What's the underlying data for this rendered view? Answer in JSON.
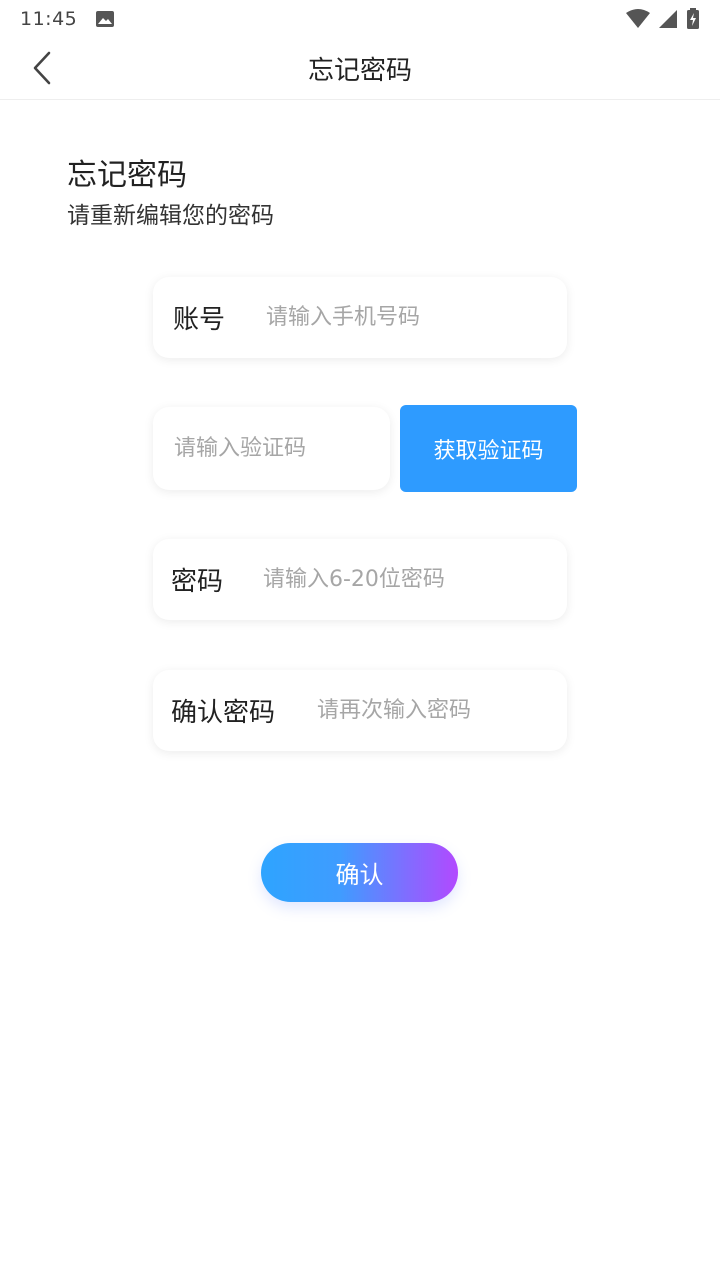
{
  "status_bar": {
    "time": "11:45",
    "icons": [
      "image-icon",
      "wifi-icon",
      "signal-icon",
      "battery-charging-icon"
    ]
  },
  "header": {
    "title": "忘记密码",
    "back_icon": "chevron-left-icon"
  },
  "intro": {
    "title": "忘记密码",
    "subtitle": "请重新编辑您的密码"
  },
  "form": {
    "account": {
      "label": "账号",
      "placeholder": "请输入手机号码",
      "value": ""
    },
    "code": {
      "placeholder": "请输入验证码",
      "value": "",
      "button_label": "获取验证码"
    },
    "password": {
      "label": "密码",
      "placeholder": "请输入6-20位密码",
      "value": ""
    },
    "confirm_password": {
      "label": "确认密码",
      "placeholder": "请再次输入密码",
      "value": ""
    }
  },
  "actions": {
    "confirm_label": "确认"
  },
  "colors": {
    "primary": "#2e9bff",
    "gradient_start": "#2ea4ff",
    "gradient_end": "#b249ff",
    "placeholder": "#a6a6a6"
  }
}
